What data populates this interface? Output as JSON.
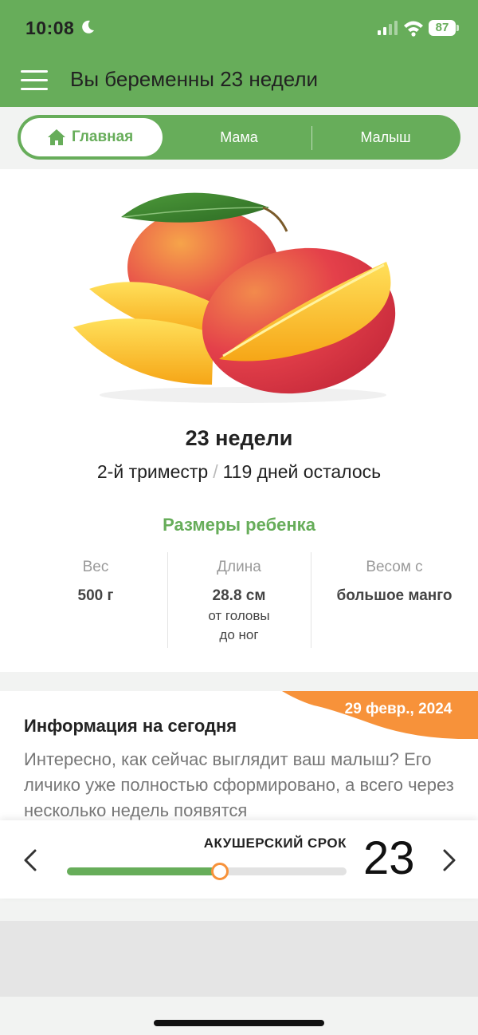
{
  "status_bar": {
    "time": "10:08",
    "battery": "87"
  },
  "header": {
    "title": "Вы беременны 23 недели"
  },
  "tabs": [
    {
      "label": "Главная",
      "active": true
    },
    {
      "label": "Мама",
      "active": false
    },
    {
      "label": "Малыш",
      "active": false
    }
  ],
  "week_card": {
    "fruit_icon": "mango-illustration",
    "week_title": "23 недели",
    "trimester": "2-й триместр",
    "separator": "/",
    "days_left": "119 дней осталось",
    "sizes_title": "Размеры ребенка",
    "weight": {
      "label": "Вес",
      "value": "500 г"
    },
    "length": {
      "label": "Длина",
      "value": "28.8 см",
      "note_line1": "от головы",
      "note_line2": "до ног"
    },
    "compare": {
      "label": "Весом с",
      "value": "большое манго"
    }
  },
  "info": {
    "date": "29 февр., 2024",
    "title": "Информация на сегодня",
    "body": "Интересно, как сейчас выглядит ваш малыш? Его личико уже полностью сформировано, а всего через несколько недель появятся"
  },
  "term_selector": {
    "label": "АКУШЕРСКИЙ СРОК",
    "week": "23",
    "progress": 0.547
  },
  "colors": {
    "primary": "#67ad5a",
    "accent": "#f7923a",
    "muted_text": "#9a9a9a"
  }
}
